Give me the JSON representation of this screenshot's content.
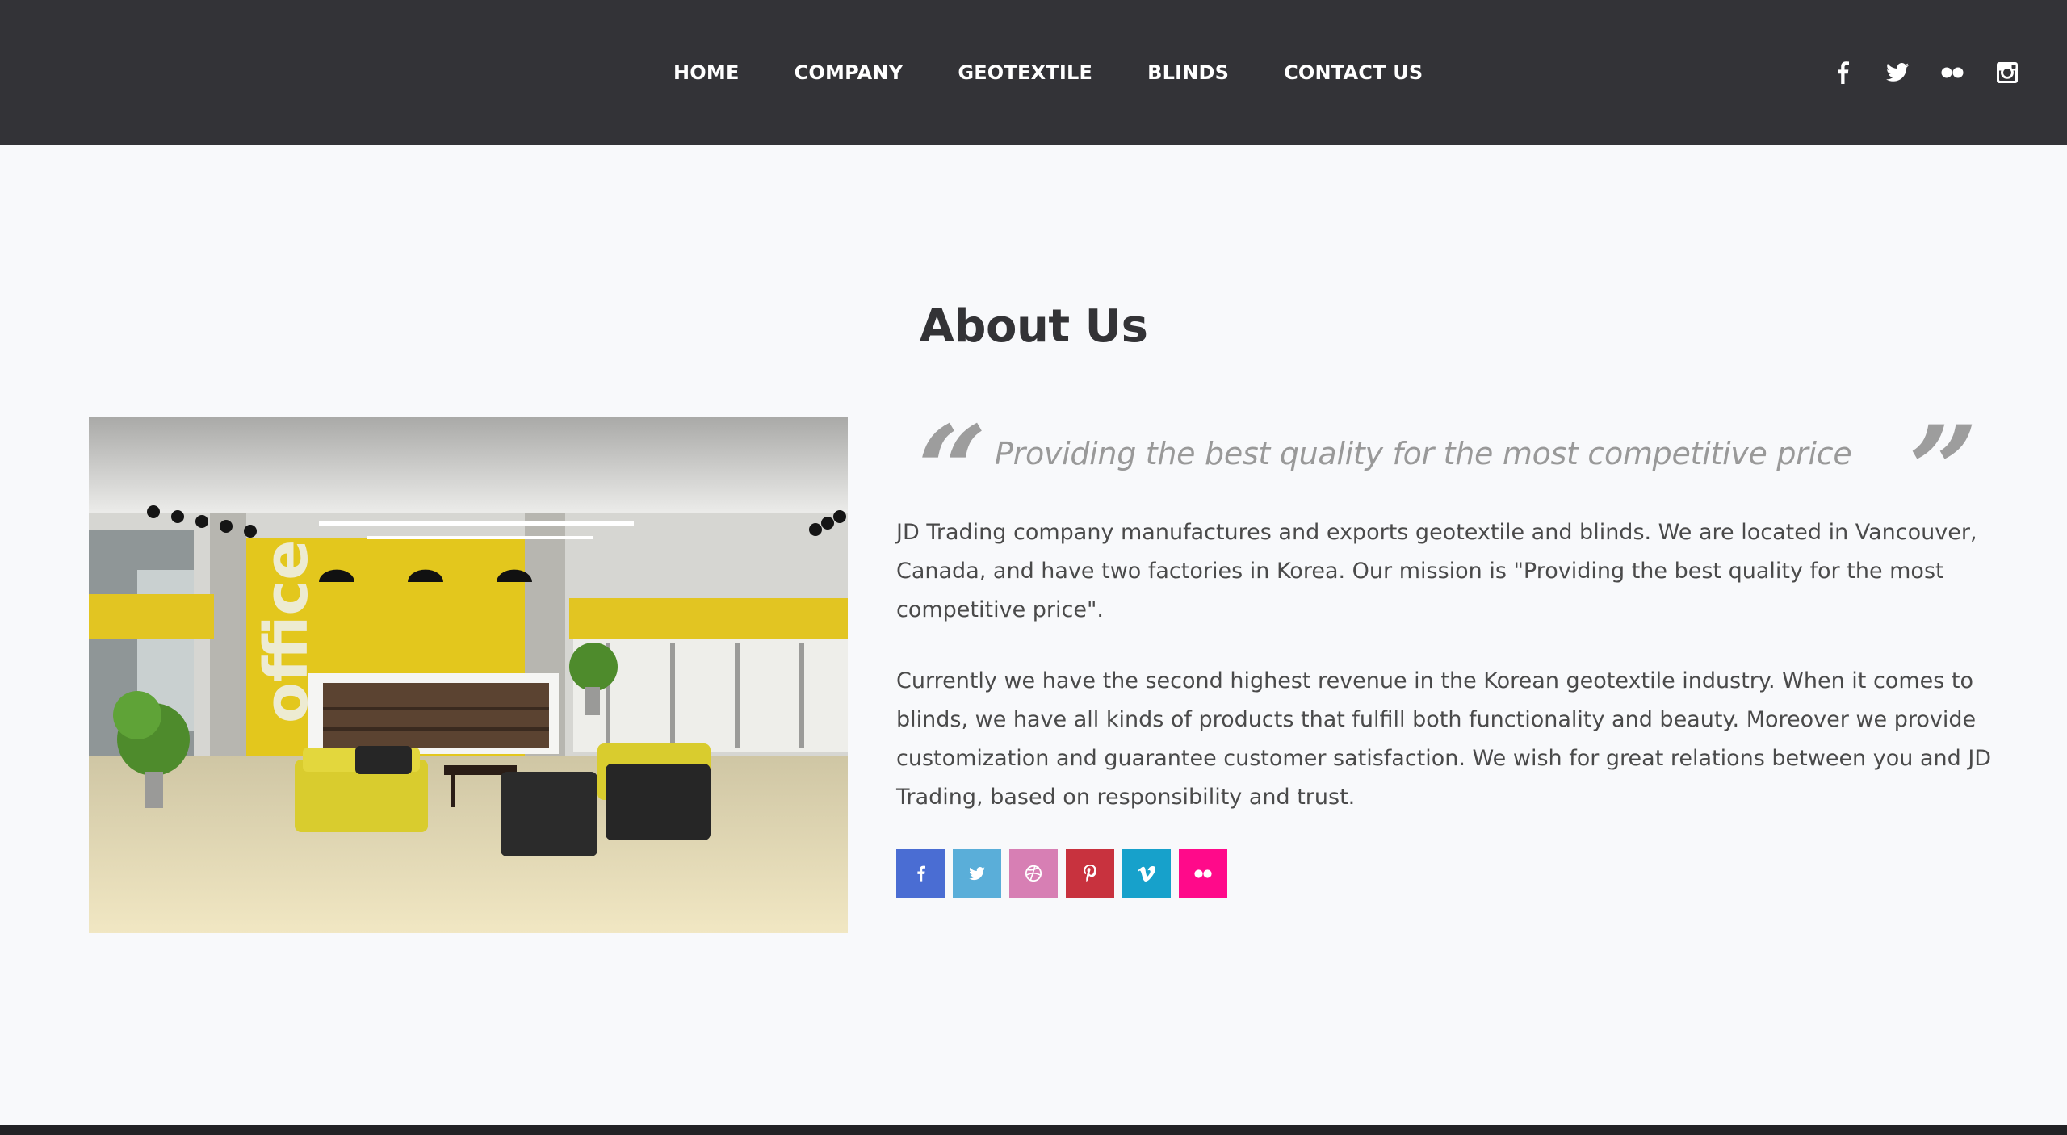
{
  "nav": {
    "items": [
      {
        "label": "HOME"
      },
      {
        "label": "COMPANY"
      },
      {
        "label": "GEOTEXTILE"
      },
      {
        "label": "BLINDS"
      },
      {
        "label": "CONTACT US"
      }
    ]
  },
  "header_social": [
    "facebook-icon",
    "twitter-icon",
    "flickr-icon",
    "instagram-icon"
  ],
  "about": {
    "title": "About Us",
    "quote": "Providing the best quality for the most competitive price",
    "paragraph1": "JD Trading company manufactures and exports geotextile and blinds. We are located in Vancouver, Canada, and have two factories in Korea. Our mission is \"Providing the best quality for the most competitive price\".",
    "paragraph2": "Currently we have the second highest revenue in the Korean geotextile industry. When it comes to blinds, we have all kinds of products that fulfill both functionality and beauty. Moreover we provide customization and guarantee customer satisfaction. We wish for great relations between you and JD Trading, based on responsibility and trust.",
    "image_sign": "office"
  },
  "share_buttons": [
    {
      "icon": "facebook-icon",
      "color": "#4a6dd3"
    },
    {
      "icon": "twitter-icon",
      "color": "#5aaed9"
    },
    {
      "icon": "dribbble-icon",
      "color": "#d77fb4"
    },
    {
      "icon": "pinterest-icon",
      "color": "#c8323e"
    },
    {
      "icon": "vimeo-icon",
      "color": "#17a1cb"
    },
    {
      "icon": "flickr-icon",
      "color": "#ff0a8a"
    }
  ],
  "colors": {
    "header_bg": "#333337",
    "page_bg": "#f8f9fb",
    "text": "#4a4a4a",
    "quote": "#999999"
  }
}
